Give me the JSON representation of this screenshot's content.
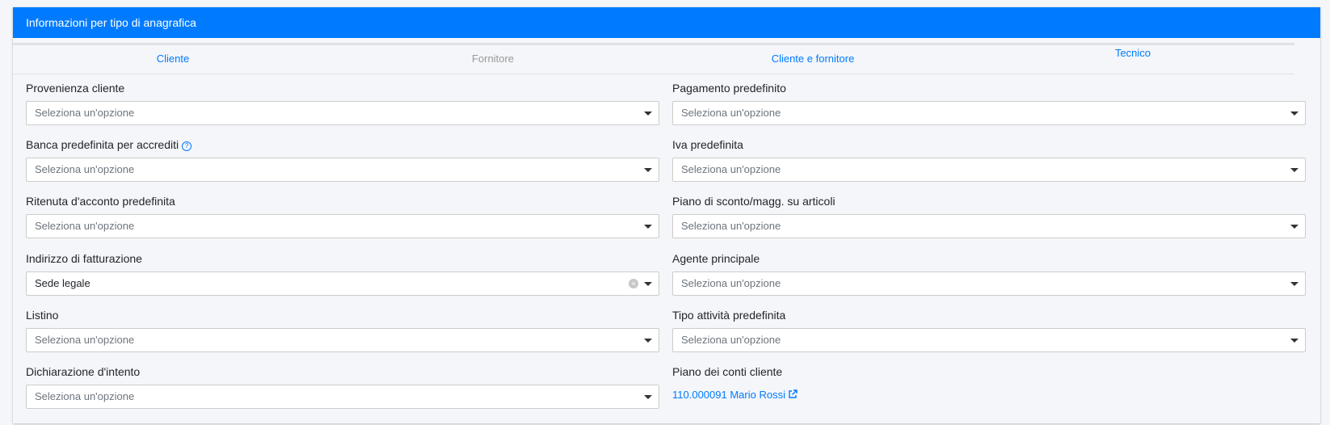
{
  "header": {
    "title": "Informazioni per tipo di anagrafica"
  },
  "tabs": [
    {
      "label": "Cliente"
    },
    {
      "label": "Fornitore"
    },
    {
      "label": "Cliente e fornitore"
    },
    {
      "label": "Tecnico"
    }
  ],
  "placeholder": "Seleziona un'opzione",
  "left": {
    "provenienza": {
      "label": "Provenienza cliente"
    },
    "banca": {
      "label": "Banca predefinita per accrediti"
    },
    "ritenuta": {
      "label": "Ritenuta d'acconto predefinita"
    },
    "indirizzo": {
      "label": "Indirizzo di fatturazione",
      "value": "Sede legale"
    },
    "listino": {
      "label": "Listino"
    },
    "dichiarazione": {
      "label": "Dichiarazione d'intento"
    }
  },
  "right": {
    "pagamento": {
      "label": "Pagamento predefinito"
    },
    "iva": {
      "label": "Iva predefinita"
    },
    "piano_sconto": {
      "label": "Piano di sconto/magg. su articoli"
    },
    "agente": {
      "label": "Agente principale"
    },
    "tipo_attivita": {
      "label": "Tipo attività predefinita"
    },
    "piano_conti": {
      "label": "Piano dei conti cliente",
      "link": "110.000091 Mario Rossi"
    }
  },
  "icons": {
    "help": "question-circle-icon",
    "external": "external-link-icon",
    "clear": "clear-icon",
    "caret": "caret-down-icon"
  },
  "colors": {
    "primary": "#007bff",
    "background": "#f4f6f9"
  }
}
